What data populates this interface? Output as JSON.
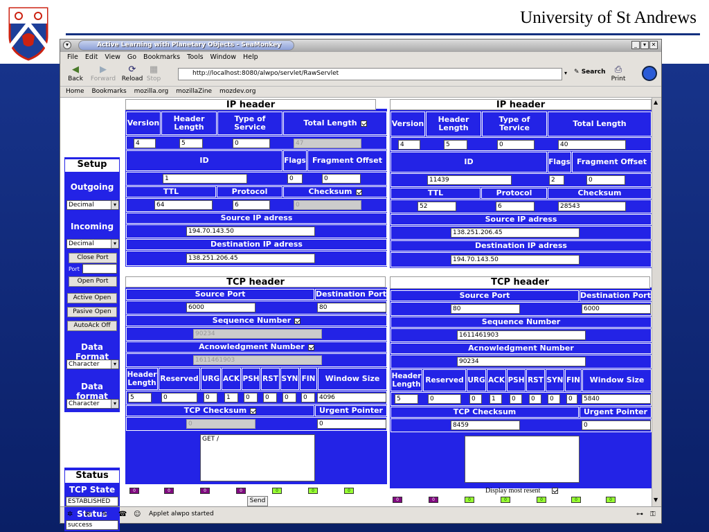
{
  "slide": {
    "institution": "University of St Andrews"
  },
  "window": {
    "title": "Active Learning with Planetary Objects - SeaMonkey"
  },
  "menu": [
    "File",
    "Edit",
    "View",
    "Go",
    "Bookmarks",
    "Tools",
    "Window",
    "Help"
  ],
  "nav": {
    "back": "Back",
    "forward": "Forward",
    "reload": "Reload",
    "stop": "Stop",
    "url": "http://localhost:8080/alwpo/servlet/RawServlet",
    "search": "Search",
    "print": "Print"
  },
  "bookmarks": [
    "Home",
    "Bookmarks",
    "mozilla.org",
    "mozillaZine",
    "mozdev.org"
  ],
  "setup": {
    "title": "Setup",
    "outgoing": "Outgoing",
    "outgoing_sel": "Decimal",
    "incoming": "Incoming",
    "incoming_sel": "Decimal",
    "close_port": "Close Port",
    "port_label": "Port",
    "open_port": "Open Port",
    "active_open": "Active Open",
    "pasive_open": "Pasive Open",
    "autoack": "AutoAck Off",
    "data_format1": "Data Format",
    "data_format1_sel": "Character",
    "data_format2": "Data format",
    "data_format2_sel": "Character"
  },
  "status": {
    "title": "Status",
    "tcp_state_label": "TCP State",
    "tcp_state": "ESTABLISHED",
    "status_label": "Status",
    "status": "success"
  },
  "labels": {
    "ip_header": "IP header",
    "tcp_header": "TCP header",
    "version": "Version",
    "header_length": "Header Length",
    "type_of_service": "Type of Service",
    "type_of_service_r": "Type of Tervice",
    "total_length": "Total Length",
    "id": "ID",
    "flags": "Flags",
    "fragment_offset": "Fragment Offset",
    "ttl": "TTL",
    "protocol": "Protocol",
    "checksum": "Checksum",
    "source_ip": "Source IP adress",
    "dest_ip": "Destination IP adress",
    "source_port": "Source Port",
    "dest_port": "Destination Port",
    "seq": "Sequence Number",
    "ack_num": "Acnowledgment Number",
    "reserved": "Reserved",
    "urg": "URG",
    "ack": "ACK",
    "psh": "PSH",
    "rst": "RST",
    "syn": "SYN",
    "fin": "FIN",
    "window_size": "Window Size",
    "tcp_checksum": "TCP Checksum",
    "urgent_pointer": "Urgent Pointer",
    "send": "Send",
    "display_recent": "Display most resent"
  },
  "left": {
    "version": "4",
    "hlen": "5",
    "tos": "0",
    "total_length": "47",
    "id": "1",
    "flags": "0",
    "frag": "0",
    "ttl": "64",
    "protocol": "6",
    "checksum": "0",
    "src_ip": "194.70.143.50",
    "dst_ip": "138.251.206.45",
    "src_port": "6000",
    "dst_port": "80",
    "seq": "90234",
    "ack_num": "1611461903",
    "hlen_tcp": "5",
    "reserved": "0",
    "urg": "0",
    "ack": "1",
    "psh": "0",
    "rst": "0",
    "syn": "0",
    "fin": "0",
    "window": "4096",
    "tcp_checksum": "0",
    "urgent": "0",
    "payload": "GET /"
  },
  "right": {
    "version": "4",
    "hlen": "5",
    "tos": "0",
    "total_length": "40",
    "id": "11439",
    "flags": "2",
    "frag": "0",
    "ttl": "52",
    "protocol": "6",
    "checksum": "28543",
    "src_ip": "138.251.206.45",
    "dst_ip": "194.70.143.50",
    "src_port": "80",
    "dst_port": "6000",
    "seq": "1611461903",
    "ack_num": "90234",
    "hlen_tcp": "5",
    "reserved": "0",
    "urg": "0",
    "ack": "1",
    "psh": "0",
    "rst": "0",
    "syn": "0",
    "fin": "0",
    "window": "5840",
    "tcp_checksum": "8459",
    "urgent": "0"
  },
  "statusbar": {
    "text": "Applet alwpo started"
  },
  "leds_left": [
    "0",
    "0",
    "0",
    "0",
    "0",
    "0",
    "0"
  ],
  "leds_right": [
    "0",
    "0",
    "0",
    "0",
    "0",
    "0",
    "0"
  ],
  "colors": {
    "panel": "#2323e6",
    "slide_bg": "#13307f",
    "led_on": "#99ff33",
    "led_off": "#800a80"
  }
}
